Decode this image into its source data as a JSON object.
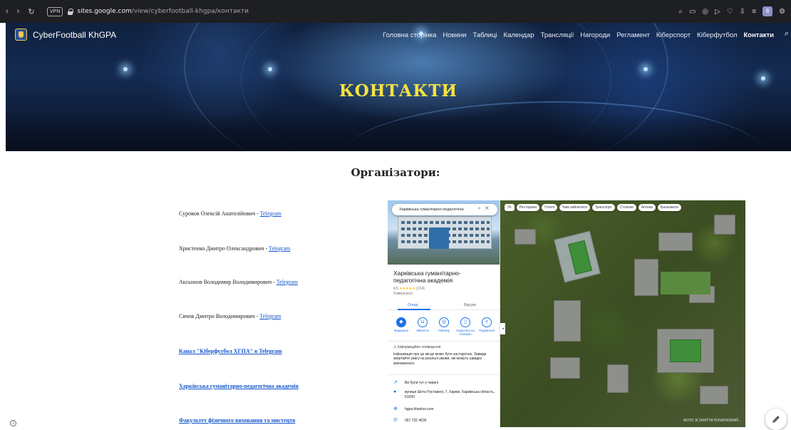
{
  "browser": {
    "vpn_label": "VPN",
    "url_host": "sites.google.com",
    "url_path": "/view/cyberfootball-khgpa/контакти",
    "icons": [
      "back-icon",
      "forward-icon",
      "reload-icon",
      "search-icon",
      "bookmark-icon",
      "camera-icon",
      "send-icon",
      "heart-icon",
      "extensions-icon",
      "menu-icon",
      "profile-icon",
      "settings-icon"
    ],
    "profile_letter": "8"
  },
  "site": {
    "name": "CyberFootball KhGPA",
    "nav": [
      "Головна сторінка",
      "Новини",
      "Таблиці",
      "Календар",
      "Трансляції",
      "Нагороди",
      "Регламент",
      "Кіберспорт",
      "Кіберфутбол",
      "Контакти"
    ],
    "active_nav": "Контакти",
    "page_title": "КОНТАКТИ"
  },
  "content": {
    "section_title": "Організатори:",
    "organizers": [
      {
        "name": "Суровов Олексій Анатолійович - ",
        "link": "Telegram"
      },
      {
        "name": "Христенко Дмитро Олександрович - ",
        "link": "Telegram"
      },
      {
        "name": "Аксьонов Володимир Володимирович - ",
        "link": "Telegram"
      },
      {
        "name": "Сичов Дмитро Володимирович - ",
        "link": "Telegram"
      }
    ],
    "links": [
      "Канал \"Кіберфутбол ХГПА\" в Telegram",
      "Харківська гуманітарно-педагогічна академія",
      "Факультет фізичного виховання та мистецтв"
    ]
  },
  "map": {
    "search_value": "Харківська гуманітарно-педагогічна",
    "lang_chip": "Уk",
    "chips": [
      "Ресторани",
      "Готелі",
      "Чим зайнятися",
      "Транспорт",
      "Стоянки",
      "Аптеки",
      "Банкомати"
    ],
    "place_name": "Харківська гуманітарно-педагогічна академія",
    "rating": "4,5",
    "stars": "★★★★★",
    "review_count": "(214)",
    "place_type": "Університет",
    "tabs": [
      "Огляд",
      "Відгуки"
    ],
    "actions": [
      {
        "icon": "◆",
        "label": "Маршрути"
      },
      {
        "icon": "⊔",
        "label": "Зберегти"
      },
      {
        "icon": "◎",
        "label": "Поблизу"
      },
      {
        "icon": "▯",
        "label": "Надіслати на телефон"
      },
      {
        "icon": "<",
        "label": "Поділитися"
      }
    ],
    "notice_title": "Інформаційне сповіщення",
    "notice_text": "Інформація про це місце може бути застарілою. Завжди звертайте увагу на реальні умови, які можуть швидко змінюватися.",
    "info": [
      {
        "icon": "↗",
        "text": "Ви були тут у червні"
      },
      {
        "icon": "●",
        "text": "вулиця Шота Руставелі, 7, Харків, Харківська область, 61000"
      },
      {
        "icon": "⊕",
        "text": "hgpa.kharkov.com"
      },
      {
        "icon": "✆",
        "text": "057 732 4630"
      }
    ],
    "brand": "ФОТО ЗІ ЗНЯТТЯ ПОЧАТКОВИЙ..."
  }
}
